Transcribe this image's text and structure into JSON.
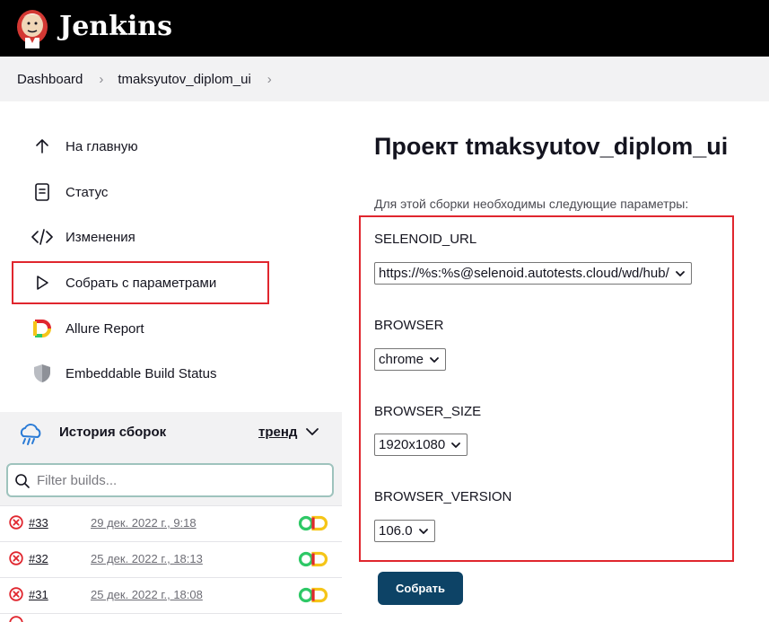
{
  "header": {
    "brand": "Jenkins",
    "logo_icon": "jenkins-butler-logo"
  },
  "breadcrumb": {
    "items": [
      "Dashboard",
      "tmaksyutov_diplom_ui"
    ]
  },
  "sidebar": {
    "tasks": [
      {
        "label": "На главную",
        "icon": "arrow-up-icon"
      },
      {
        "label": "Статус",
        "icon": "document-icon"
      },
      {
        "label": "Изменения",
        "icon": "code-icon"
      },
      {
        "label": "Собрать с параметрами",
        "icon": "play-icon"
      },
      {
        "label": "Allure Report",
        "icon": "allure-icon"
      },
      {
        "label": "Embeddable Build Status",
        "icon": "shield-icon"
      }
    ]
  },
  "history": {
    "title": "История сборок",
    "trend_label": "тренд",
    "filter_placeholder": "Filter builds...",
    "builds": [
      {
        "number": "#33",
        "date": "29 дек. 2022 г., 9:18",
        "status": "failed"
      },
      {
        "number": "#32",
        "date": "25 дек. 2022 г., 18:13",
        "status": "failed"
      },
      {
        "number": "#31",
        "date": "25 дек. 2022 г., 18:08",
        "status": "failed"
      }
    ]
  },
  "main": {
    "title": "Проект tmaksyutov_diplom_ui",
    "description": "Для этой сборки необходимы следующие параметры:",
    "params": [
      {
        "name": "SELENOID_URL",
        "value": "https://%s:%s@selenoid.autotests.cloud/wd/hub/"
      },
      {
        "name": "BROWSER",
        "value": "chrome"
      },
      {
        "name": "BROWSER_SIZE",
        "value": "1920x1080"
      },
      {
        "name": "BROWSER_VERSION",
        "value": "106.0"
      }
    ],
    "submit_label": "Собрать"
  },
  "colors": {
    "header_bg": "#000000",
    "highlight_border": "#e0262e",
    "submit_bg": "#0d4366",
    "fail_red": "#e0262e",
    "allure_green": "#2ec866",
    "allure_yellow": "#f5c518"
  }
}
